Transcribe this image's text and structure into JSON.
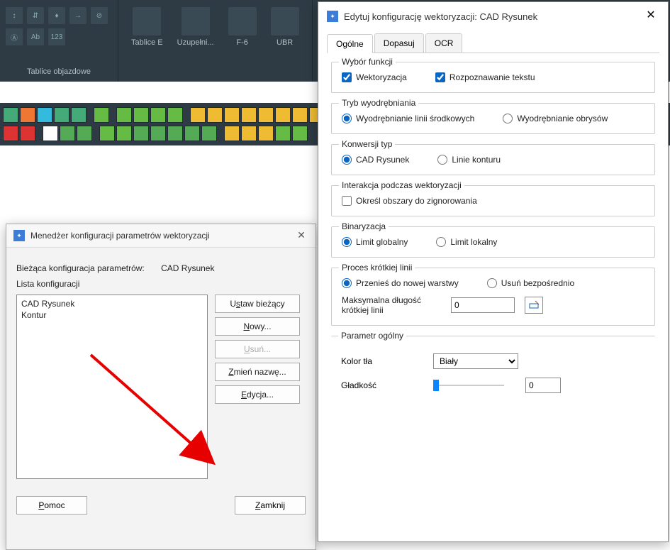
{
  "ribbon": {
    "group1_label": "Tablice objazdowe",
    "big": [
      {
        "label": "Tablice E"
      },
      {
        "label": "Uzupełni..."
      },
      {
        "label": "F-6"
      },
      {
        "label": "UBR"
      }
    ]
  },
  "managerDialog": {
    "title": "Menedżer konfiguracji parametrów wektoryzacji",
    "current_label": "Bieżąca konfiguracja parametrów:",
    "current_value": "CAD Rysunek",
    "list_label": "Lista konfiguracji",
    "items": [
      "CAD Rysunek",
      "Kontur"
    ],
    "buttons": {
      "set_current": "Ustaw bieżący",
      "new": "Nowy...",
      "delete": "Usuń...",
      "rename": "Zmień nazwę...",
      "edit": "Edycja..."
    },
    "footer": {
      "help": "Pomoc",
      "close": "Zamknij"
    }
  },
  "editDialog": {
    "title": "Edytuj konfigurację wektoryzacji: CAD Rysunek",
    "tabs": {
      "general": "Ogólne",
      "fit": "Dopasuj",
      "ocr": "OCR"
    },
    "sections": {
      "func": {
        "legend": "Wybór funkcji",
        "vectorize": "Wektoryzacja",
        "recognize": "Rozpoznawanie tekstu"
      },
      "extract": {
        "legend": "Tryb wyodrębniania",
        "center": "Wyodrębnianie linii środkowych",
        "outline": "Wyodrębnianie obrysów"
      },
      "convert": {
        "legend": "Konwersji typ",
        "cad": "CAD Rysunek",
        "contour": "Linie konturu"
      },
      "interact": {
        "legend": "Interakcja podczas wektoryzacji",
        "ignore": "Określ obszary do zignorowania"
      },
      "binar": {
        "legend": "Binaryzacja",
        "global": "Limit globalny",
        "local": "Limit lokalny"
      },
      "short": {
        "legend": "Proces krótkiej linii",
        "move": "Przenieś do nowej warstwy",
        "delete": "Usuń bezpośrednio",
        "maxlen_label": "Maksymalna długość krótkiej linii",
        "maxlen_value": "0"
      },
      "general": {
        "legend": "Parametr ogólny",
        "bgcolor_label": "Kolor tła",
        "bgcolor_value": "Biały",
        "smooth_label": "Gładkość",
        "smooth_value": "0"
      }
    }
  }
}
